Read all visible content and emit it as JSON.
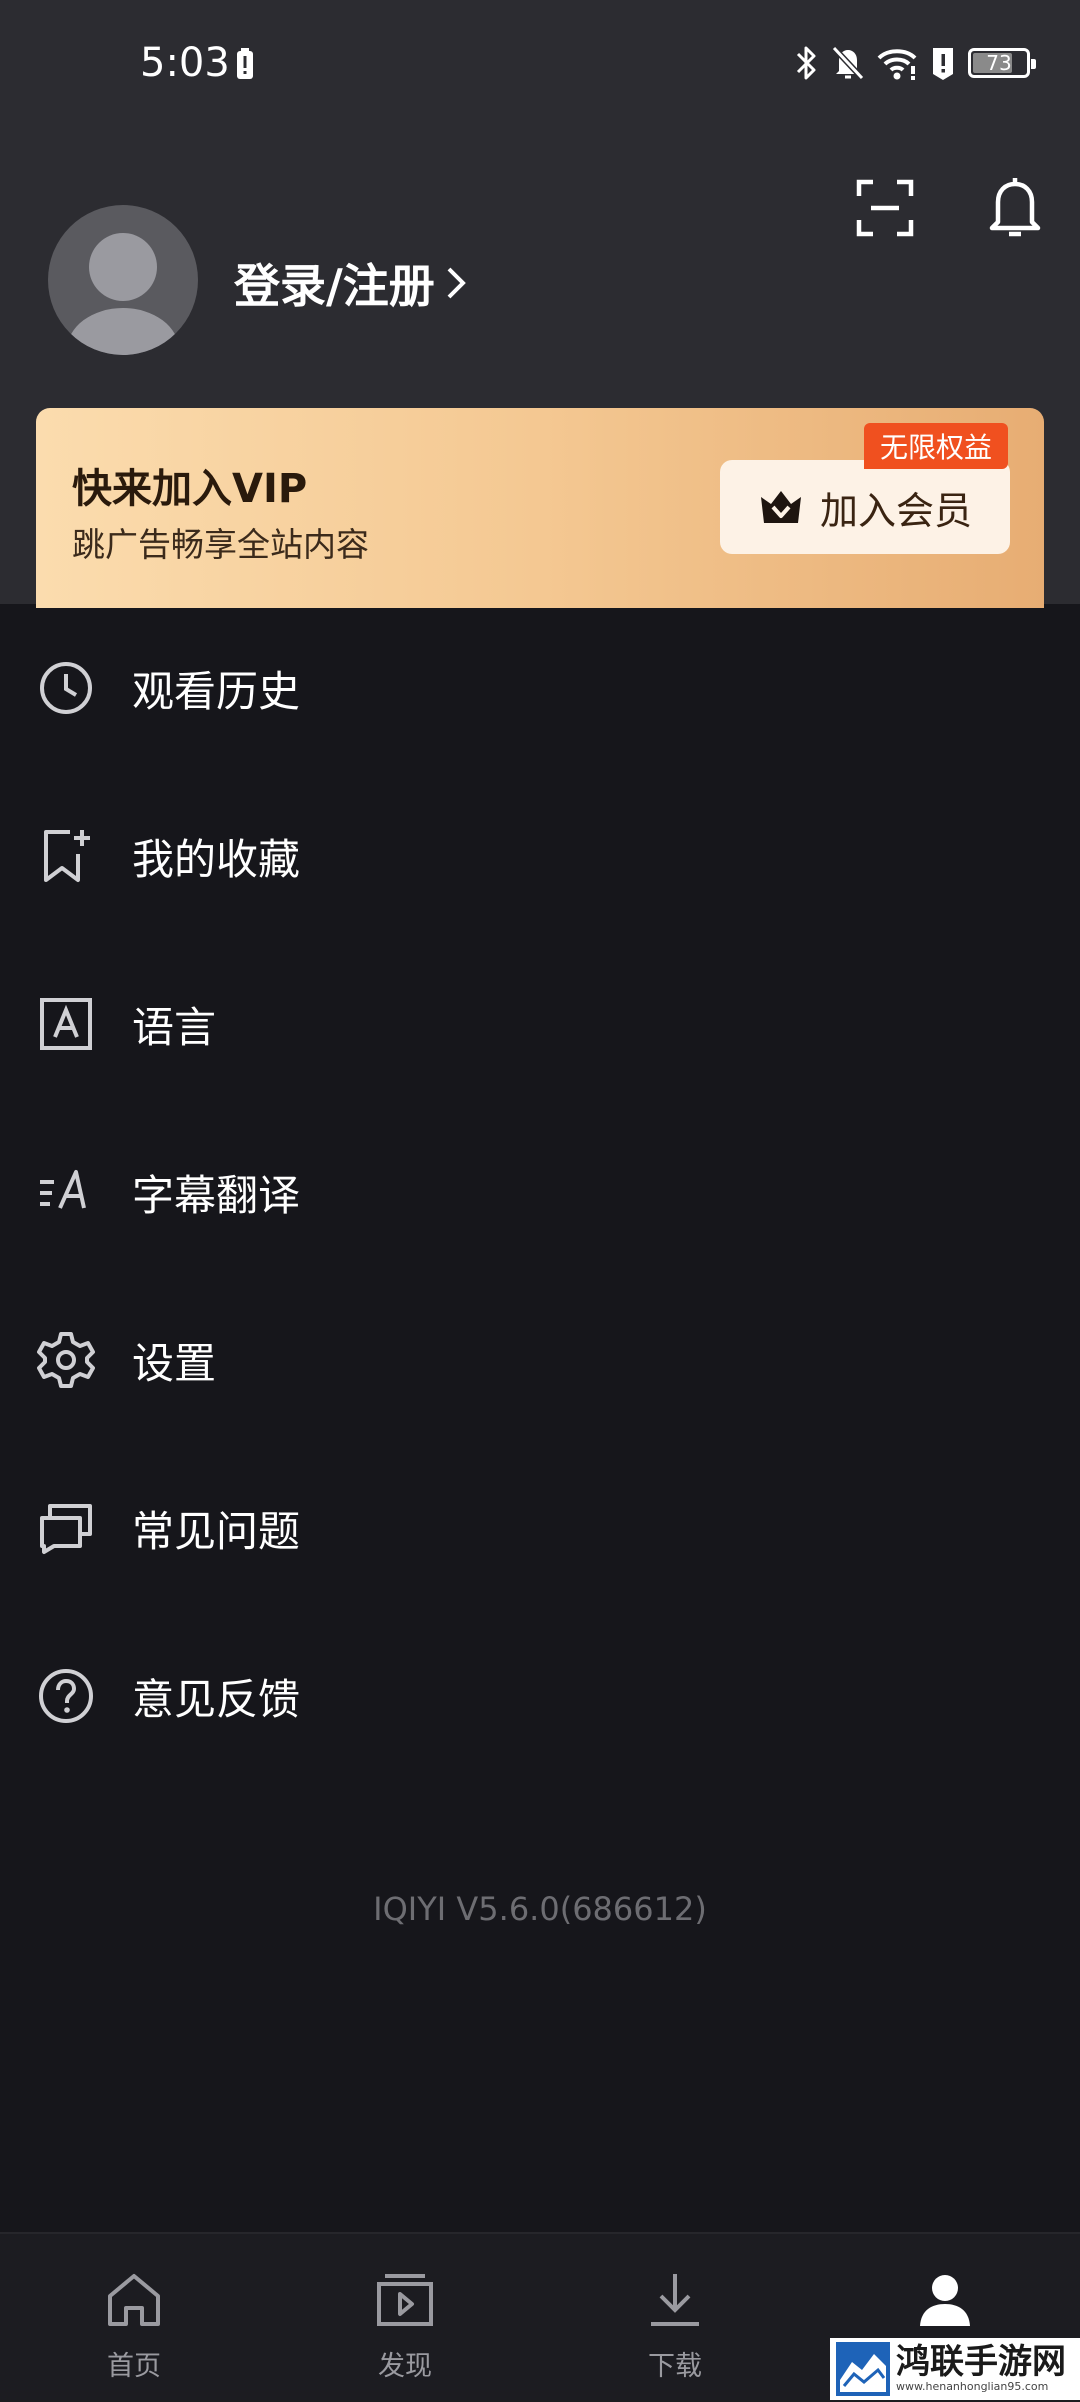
{
  "status_bar": {
    "time": "5:03",
    "battery_level": "73"
  },
  "header": {
    "login_label": "登录/注册"
  },
  "vip": {
    "title": "快来加入VIP",
    "subtitle": "跳广告畅享全站内容",
    "button_label": "加入会员",
    "badge": "无限权益"
  },
  "menu": {
    "items": [
      {
        "label": "观看历史",
        "icon": "clock-icon"
      },
      {
        "label": "我的收藏",
        "icon": "bookmark-add-icon"
      },
      {
        "label": "语言",
        "icon": "language-icon"
      },
      {
        "label": "字幕翻译",
        "icon": "subtitle-translate-icon"
      },
      {
        "label": "设置",
        "icon": "gear-icon"
      },
      {
        "label": "常见问题",
        "icon": "chat-bubbles-icon"
      },
      {
        "label": "意见反馈",
        "icon": "question-icon"
      }
    ]
  },
  "version": "IQIYI V5.6.0(686612)",
  "tabbar": {
    "tabs": [
      {
        "label": "首页",
        "icon": "home-icon"
      },
      {
        "label": "发现",
        "icon": "discover-icon"
      },
      {
        "label": "下载",
        "icon": "download-icon"
      },
      {
        "label": "",
        "icon": "profile-icon",
        "active": true
      }
    ]
  },
  "watermark": {
    "text": "鸿联手游网",
    "url": "www.henanhonglian95.com"
  },
  "colors": {
    "background": "#16161b",
    "header_background": "#2c2c31",
    "vip_gradient_start": "#fbdcae",
    "vip_gradient_end": "#e7ad73",
    "badge": "#f0501f"
  }
}
